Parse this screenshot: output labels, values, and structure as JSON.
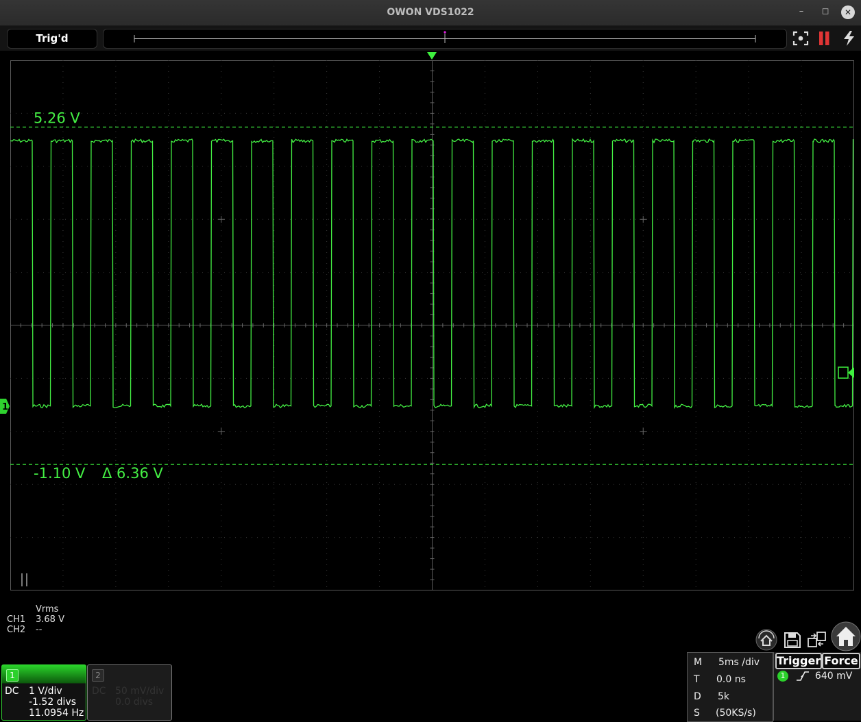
{
  "window": {
    "title": "OWON VDS1022"
  },
  "toolbar": {
    "trigger_status": "Trig'd"
  },
  "scope": {
    "cursor_upper_label": "5.26 V",
    "cursor_lower_label": "-1.10 V",
    "cursor_delta_label": "Δ 6.36 V",
    "channel_marker_label": "1",
    "trace_color": "#44f044",
    "waveform": {
      "type": "square",
      "high_level_v": 5.0,
      "low_level_v": 0.0,
      "frequency_hz": 11.0954,
      "cursor_upper_v": 5.26,
      "cursor_lower_v": -1.1
    }
  },
  "measurements": {
    "header": "Vrms",
    "rows": [
      {
        "channel": "CH1",
        "value": "3.68 V"
      },
      {
        "channel": "CH2",
        "value": "--"
      }
    ]
  },
  "channels": {
    "ch1": {
      "number": "1",
      "coupling": "DC",
      "scale": "1 V/div",
      "offset": "-1.52 divs",
      "frequency": "11.0954 Hz"
    },
    "ch2": {
      "number": "2",
      "coupling": "DC",
      "scale": "50 mV/div",
      "offset": "0.0 divs"
    }
  },
  "timebase": {
    "rows": [
      {
        "key": "M",
        "value": "5ms /div"
      },
      {
        "key": "T",
        "value": "0.0 ns"
      },
      {
        "key": "D",
        "value": "5k"
      },
      {
        "key": "S",
        "value": "(50KS/s)"
      }
    ]
  },
  "trigger": {
    "trigger_label": "Trigger",
    "force_label": "Force",
    "source": "1",
    "level": "640 mV"
  },
  "icons": [
    "fullscreen-icon",
    "stop-icon",
    "auto-icon",
    "auto-setup-icon",
    "save-icon",
    "transfer-icon",
    "home-icon"
  ]
}
